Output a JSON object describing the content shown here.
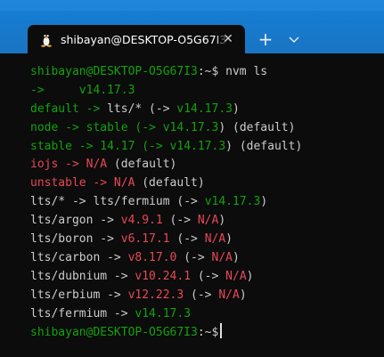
{
  "window": {
    "tab_title": "shibayan@DESKTOP-O5G67I3: ~",
    "tab_close_glyph": "✕",
    "new_tab_glyph": "+",
    "accent_color": "#1a74c2"
  },
  "terminal": {
    "prompt_user": "shibayan@DESKTOP-O5G67I3",
    "prompt_path": ":~$",
    "command": " nvm ls",
    "lines": [
      [
        "->     ",
        "v14.17.3"
      ],
      [
        "default -> ",
        "lts/*",
        " (-> ",
        "v14.17.3",
        ")"
      ],
      [
        "node -> stable (-> ",
        "v14.17.3",
        ") (default)"
      ],
      [
        "stable -> 14.17 (-> ",
        "v14.17.3",
        ") (default)"
      ],
      [
        "iojs -> ",
        "N/A",
        " (default)"
      ],
      [
        "unstable -> ",
        "N/A",
        " (default)"
      ],
      [
        "lts/* -> ",
        "lts/fermium",
        " (-> ",
        "v14.17.3",
        ")"
      ],
      [
        "lts/argon -> ",
        "v4.9.1",
        " (-> ",
        "N/A",
        ")"
      ],
      [
        "lts/boron -> ",
        "v6.17.1",
        " (-> ",
        "N/A",
        ")"
      ],
      [
        "lts/carbon -> ",
        "v8.17.0",
        " (-> ",
        "N/A",
        ")"
      ],
      [
        "lts/dubnium -> ",
        "v10.24.1",
        " (-> ",
        "N/A",
        ")"
      ],
      [
        "lts/erbium -> ",
        "v12.22.3",
        " (-> ",
        "N/A",
        ")"
      ],
      [
        "lts/fermium -> ",
        "v14.17.3"
      ]
    ]
  }
}
